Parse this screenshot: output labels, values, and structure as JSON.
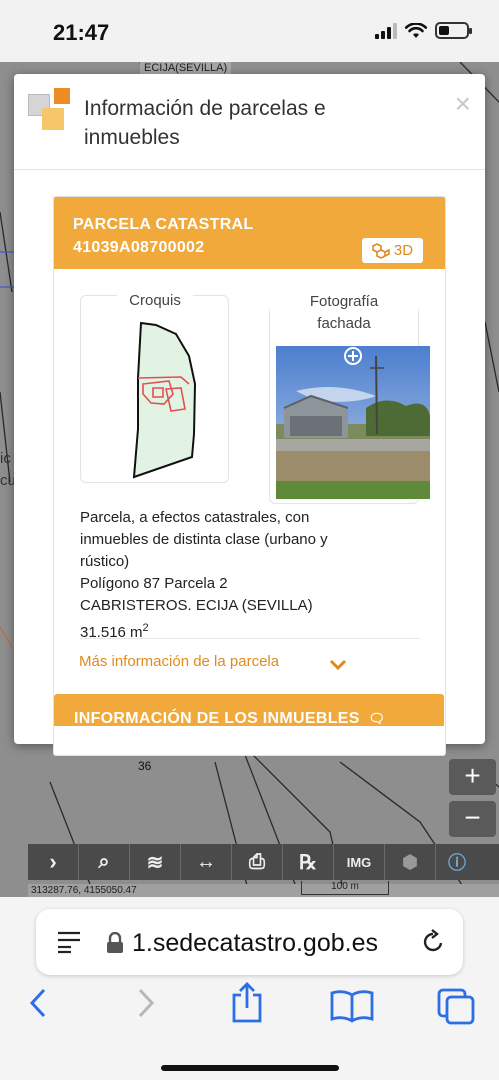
{
  "status": {
    "time": "21:47"
  },
  "map": {
    "top_label": "ECIJA(SEVILLA)",
    "parcel_number": "36",
    "left_fragments": [
      "ic",
      "cu"
    ],
    "coords": "313287.76, 4155050.47",
    "scale": "100 m",
    "zoom_in": "+",
    "zoom_out": "−",
    "toolbar": [
      {
        "name": "expand",
        "glyph": "›"
      },
      {
        "name": "search",
        "glyph": "⌕"
      },
      {
        "name": "layers",
        "glyph": "≋"
      },
      {
        "name": "measure",
        "glyph": "↔"
      },
      {
        "name": "print",
        "glyph": "⎙"
      },
      {
        "name": "ref",
        "glyph": "℞"
      },
      {
        "name": "img",
        "glyph": "IMG"
      },
      {
        "name": "3d",
        "glyph": "⬢"
      },
      {
        "name": "info",
        "glyph": "ⓘ"
      }
    ]
  },
  "modal": {
    "title": "Información de parcelas e inmuebles",
    "close": "×",
    "parcel": {
      "heading_line1": "PARCELA CATASTRAL",
      "heading_line2": "41039A08700002",
      "btn_3d": "3D",
      "croquis_label": "Croquis",
      "foto_label_1": "Fotografía",
      "foto_label_2": "fachada",
      "desc_line1": "Parcela, a efectos catastrales, con",
      "desc_line2": "inmuebles de distinta clase (urbano y",
      "desc_line3": "rústico)",
      "desc_line4": "Polígono 87 Parcela 2",
      "desc_line5": "CABRISTEROS. ECIJA (SEVILLA)",
      "area": "31.516 m",
      "area_sup": "2",
      "more_link": "Más información de la parcela"
    },
    "inmuebles_heading": "INFORMACIÓN DE LOS INMUEBLES"
  },
  "browser": {
    "url": "1.sedecatastro.gob.es"
  },
  "colors": {
    "accent": "#f0a93a",
    "link": "#e08a1e"
  }
}
